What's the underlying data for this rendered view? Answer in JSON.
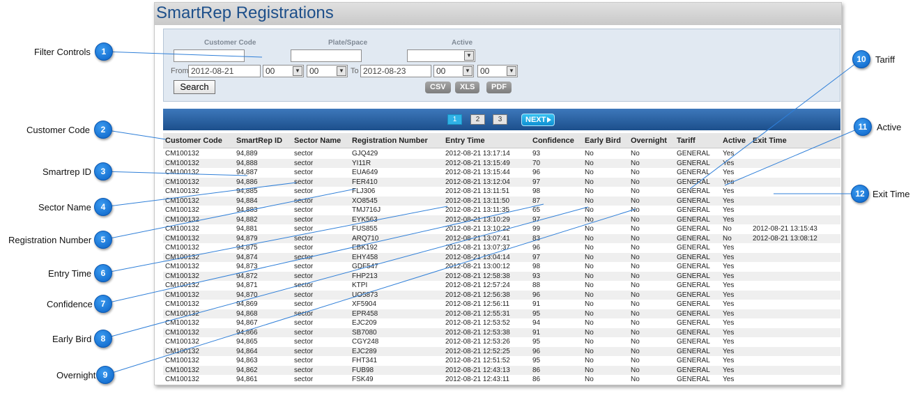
{
  "title": "SmartRep Registrations",
  "filters": {
    "customer_code_label": "Customer Code",
    "plate_space_label": "Plate/Space",
    "active_label": "Active",
    "customer_code_value": "",
    "plate_space_value": "",
    "active_value": "",
    "from_label": "From",
    "from_date": "2012-08-21",
    "from_hour": "00",
    "from_minute": "00",
    "to_label": "To",
    "to_date": "2012-08-23",
    "to_hour": "00",
    "to_minute": "00",
    "search_label": "Search",
    "csv_label": "CSV",
    "xls_label": "XLS",
    "pdf_label": "PDF"
  },
  "pager": {
    "pages": [
      "1",
      "2",
      "3"
    ],
    "current": "1",
    "next_label": "NEXT"
  },
  "columns": [
    "Customer Code",
    "SmartRep ID",
    "Sector Name",
    "Registration Number",
    "Entry Time",
    "Confidence",
    "Early Bird",
    "Overnight",
    "Tariff",
    "Active",
    "Exit Time"
  ],
  "rows": [
    [
      "CM100132",
      "94,889",
      "sector",
      "GJQ429",
      "2012-08-21 13:17:14",
      "93",
      "No",
      "No",
      "GENERAL",
      "Yes",
      ""
    ],
    [
      "CM100132",
      "94,888",
      "sector",
      "YI11R",
      "2012-08-21 13:15:49",
      "70",
      "No",
      "No",
      "GENERAL",
      "Yes",
      ""
    ],
    [
      "CM100132",
      "94,887",
      "sector",
      "EUA649",
      "2012-08-21 13:15:44",
      "96",
      "No",
      "No",
      "GENERAL",
      "Yes",
      ""
    ],
    [
      "CM100132",
      "94,886",
      "sector",
      "FER410",
      "2012-08-21 13:12:04",
      "97",
      "No",
      "No",
      "GENERAL",
      "Yes",
      ""
    ],
    [
      "CM100132",
      "94,885",
      "sector",
      "FLJ306",
      "2012-08-21 13:11:51",
      "98",
      "No",
      "No",
      "GENERAL",
      "Yes",
      ""
    ],
    [
      "CM100132",
      "94,884",
      "sector",
      "XO8545",
      "2012-08-21 13:11:50",
      "87",
      "No",
      "No",
      "GENERAL",
      "Yes",
      ""
    ],
    [
      "CM100132",
      "94,883",
      "sector",
      "TMJ716J",
      "2012-08-21 13:11:35",
      "65",
      "No",
      "No",
      "GENERAL",
      "Yes",
      ""
    ],
    [
      "CM100132",
      "94,882",
      "sector",
      "EYK563",
      "2012-08-21 13:10:29",
      "97",
      "No",
      "No",
      "GENERAL",
      "Yes",
      ""
    ],
    [
      "CM100132",
      "94,881",
      "sector",
      "FUS855",
      "2012-08-21 13:10:22",
      "99",
      "No",
      "No",
      "GENERAL",
      "No",
      "2012-08-21 13:15:43"
    ],
    [
      "CM100132",
      "94,879",
      "sector",
      "ARQ710",
      "2012-08-21 13:07:41",
      "83",
      "No",
      "No",
      "GENERAL",
      "No",
      "2012-08-21 13:08:12"
    ],
    [
      "CM100132",
      "94,875",
      "sector",
      "EBK192",
      "2012-08-21 13:07:37",
      "96",
      "No",
      "No",
      "GENERAL",
      "Yes",
      ""
    ],
    [
      "CM100132",
      "94,874",
      "sector",
      "EHY458",
      "2012-08-21 13:04:14",
      "97",
      "No",
      "No",
      "GENERAL",
      "Yes",
      ""
    ],
    [
      "CM100132",
      "94,873",
      "sector",
      "GDF547",
      "2012-08-21 13:00:12",
      "98",
      "No",
      "No",
      "GENERAL",
      "Yes",
      ""
    ],
    [
      "CM100132",
      "94,872",
      "sector",
      "FHP213",
      "2012-08-21 12:58:38",
      "93",
      "No",
      "No",
      "GENERAL",
      "Yes",
      ""
    ],
    [
      "CM100132",
      "94,871",
      "sector",
      "KTPI",
      "2012-08-21 12:57:24",
      "88",
      "No",
      "No",
      "GENERAL",
      "Yes",
      ""
    ],
    [
      "CM100132",
      "94,870",
      "sector",
      "UO5873",
      "2012-08-21 12:56:38",
      "96",
      "No",
      "No",
      "GENERAL",
      "Yes",
      ""
    ],
    [
      "CM100132",
      "94,869",
      "sector",
      "XF5904",
      "2012-08-21 12:56:11",
      "91",
      "No",
      "No",
      "GENERAL",
      "Yes",
      ""
    ],
    [
      "CM100132",
      "94,868",
      "sector",
      "EPR458",
      "2012-08-21 12:55:31",
      "95",
      "No",
      "No",
      "GENERAL",
      "Yes",
      ""
    ],
    [
      "CM100132",
      "94,867",
      "sector",
      "EJC209",
      "2012-08-21 12:53:52",
      "94",
      "No",
      "No",
      "GENERAL",
      "Yes",
      ""
    ],
    [
      "CM100132",
      "94,866",
      "sector",
      "SB7080",
      "2012-08-21 12:53:38",
      "91",
      "No",
      "No",
      "GENERAL",
      "Yes",
      ""
    ],
    [
      "CM100132",
      "94,865",
      "sector",
      "CGY248",
      "2012-08-21 12:53:26",
      "95",
      "No",
      "No",
      "GENERAL",
      "Yes",
      ""
    ],
    [
      "CM100132",
      "94,864",
      "sector",
      "EJC289",
      "2012-08-21 12:52:25",
      "96",
      "No",
      "No",
      "GENERAL",
      "Yes",
      ""
    ],
    [
      "CM100132",
      "94,863",
      "sector",
      "FHT341",
      "2012-08-21 12:51:52",
      "95",
      "No",
      "No",
      "GENERAL",
      "Yes",
      ""
    ],
    [
      "CM100132",
      "94,862",
      "sector",
      "FUB98",
      "2012-08-21 12:43:13",
      "86",
      "No",
      "No",
      "GENERAL",
      "Yes",
      ""
    ],
    [
      "CM100132",
      "94,861",
      "sector",
      "FSK49",
      "2012-08-21 12:43:11",
      "86",
      "No",
      "No",
      "GENERAL",
      "Yes",
      ""
    ]
  ],
  "callouts": [
    {
      "num": "1",
      "label": "Filter Controls"
    },
    {
      "num": "2",
      "label": "Customer Code"
    },
    {
      "num": "3",
      "label": "Smartrep ID"
    },
    {
      "num": "4",
      "label": "Sector Name"
    },
    {
      "num": "5",
      "label": "Registration Number"
    },
    {
      "num": "6",
      "label": "Entry Time"
    },
    {
      "num": "7",
      "label": "Confidence"
    },
    {
      "num": "8",
      "label": "Early Bird"
    },
    {
      "num": "9",
      "label": "Overnight"
    },
    {
      "num": "10",
      "label": "Tariff"
    },
    {
      "num": "11",
      "label": "Active"
    },
    {
      "num": "12",
      "label": "Exit Time"
    }
  ],
  "colors": {
    "title": "#1d4f8a",
    "pager_bar": "#1c4f8c",
    "callout": "#0a62c6",
    "filter_panel": "#e1e9f2"
  }
}
